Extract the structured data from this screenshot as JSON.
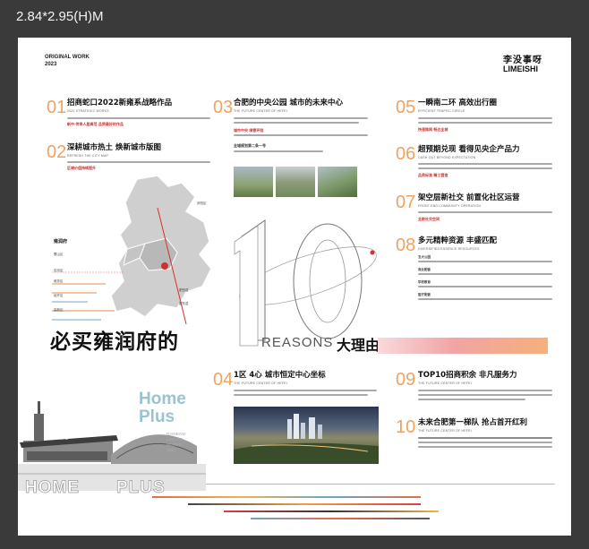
{
  "canvas_label": "2.84*2.95(H)M",
  "header": {
    "original_work": "ORIGINAL WORK",
    "year": "2023",
    "logo_cn": "李没事呀",
    "logo_en": "LIMEISHI"
  },
  "sections": [
    {
      "num": "01",
      "title": "招商蛇口2022新雍系战略作品",
      "sub": "2022 STRATEGIC WORKS",
      "highlight": "新中·传承人居典范 品质最好的作品"
    },
    {
      "num": "02",
      "title": "深耕城市热土 焕新城市版图",
      "sub": "REFRESH THE CITY MAP",
      "highlight": "区域价值持续提升"
    },
    {
      "num": "03",
      "title": "合肥的中央公园 城市的未来中心",
      "sub": "THE FUTURE CENTER OF HEFEI",
      "highlight": "城市中央 绿意环绕",
      "highlight2": "全城规划第二条一号"
    },
    {
      "num": "04",
      "title": "1区 4心 城市恒定中心坐标",
      "sub": "THE FUTURE CENTER OF HEFEI"
    },
    {
      "num": "05",
      "title": "一瞬南二环 高效出行圈",
      "sub": "EFFICIENT TRAFFIC CIRCLE",
      "highlight": "快速路网 畅达全城"
    },
    {
      "num": "06",
      "title": "超预期兑现 看得见央企产品力",
      "sub": "CASH OUT BEYOND EXPECTATION",
      "highlight": "品质标准 精工营造"
    },
    {
      "num": "07",
      "title": "架空层新社交 前置化社区运营",
      "sub": "FRONT-END COMMUNITY OPERATION",
      "highlight": "全龄社交空间"
    },
    {
      "num": "08",
      "title": "多元精粹资源 丰盛匹配",
      "sub": "DIVERSIFIED ESSENCE RESOURCES",
      "items": [
        "五大公园",
        "商业配套",
        "学校教育",
        "医疗配套"
      ]
    },
    {
      "num": "09",
      "title": "TOP10招商积余 非凡服务力",
      "sub": "THE FUTURE CENTER OF HEFEI"
    },
    {
      "num": "10",
      "title": "未来合肥第一梯队 抢占首开红利",
      "sub": "THE FUTURE CENTER OF HEFEI"
    }
  ],
  "map_labels": [
    "雍润府",
    "蜀山区",
    "包河区",
    "庐阳区",
    "肥西县",
    "肥东县",
    "政务区",
    "经开区",
    "高新区"
  ],
  "center": {
    "ten": "10",
    "reasons": "REASONS",
    "big_title": "必买雍润府的",
    "big_right": "大理由"
  },
  "home_plus": {
    "logo_line1": "Home",
    "logo_line2": "Plus",
    "sub_lines": [
      "RAINBOW",
      "LINKING",
      "WORLD",
      "2023"
    ],
    "home_outline": "HOME",
    "plus_outline": "PLUS",
    "building_sign": "合肥南站"
  },
  "colors": {
    "accent_orange": "#f1a25d",
    "accent_red": "#d23030",
    "home_plus_blue": "#9bc3cf"
  }
}
